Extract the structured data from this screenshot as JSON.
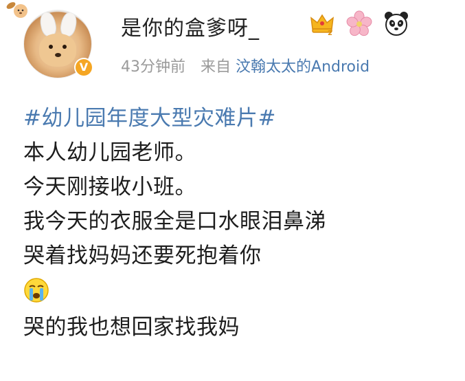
{
  "post": {
    "username": "是你的盒爹呀_",
    "time": "43分钟前",
    "source_prefix": "来自",
    "source": "汶翰太太的Android",
    "topic": "#幼儿园年度大型灾难片#",
    "lines": [
      "本人幼儿园老师。",
      "今天刚接收小班。",
      "我今天的衣服全是口水眼泪鼻涕",
      "哭着找妈妈还要死抱着你"
    ],
    "last_line": "哭的我也想回家找我妈"
  },
  "icons": {
    "avatar": "shiba-dog-bunny-hat-avatar",
    "verified": "verified-v-badge-icon",
    "badge1": "crown-icon",
    "badge2": "flower-icon",
    "badge3": "panda-icon",
    "emoji": "crying-face-emoji",
    "corner": "dog-drumstick-icon"
  },
  "colors": {
    "link": "#4a7ab0",
    "meta": "#9a9a9a",
    "verified": "#f5a623"
  }
}
